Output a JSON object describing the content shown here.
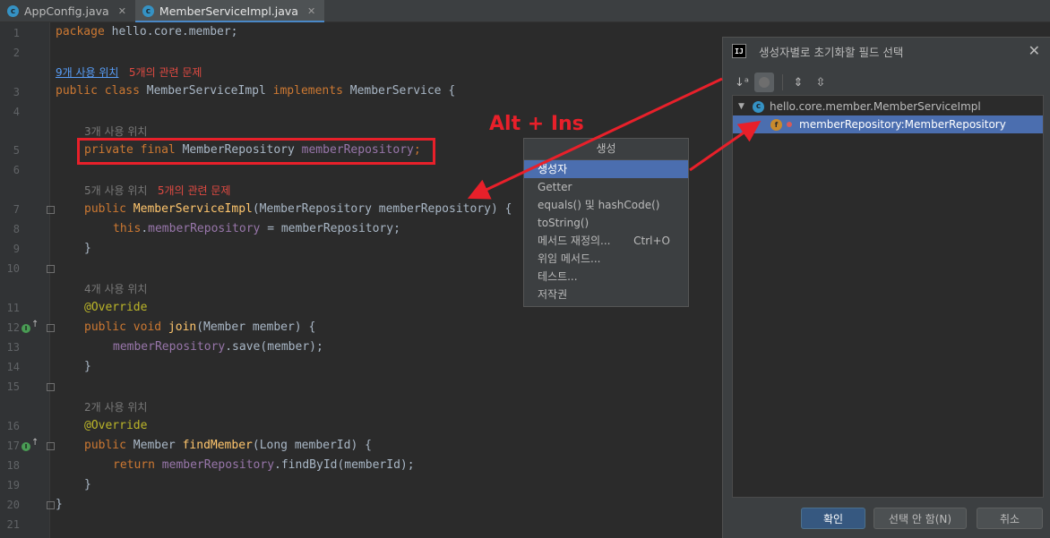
{
  "tabs": [
    {
      "label": "AppConfig.java",
      "icon": "class-icon"
    },
    {
      "label": "MemberServiceImpl.java",
      "icon": "class-icon"
    }
  ],
  "editor": {
    "line_numbers": [
      "1",
      "2",
      "3",
      "4",
      "5",
      "6",
      "7",
      "8",
      "9",
      "10",
      "11",
      "12",
      "13",
      "14",
      "15",
      "16",
      "17",
      "18",
      "19",
      "20",
      "21"
    ],
    "code": {
      "l1_kw": "package",
      "l1_rest": " hello.core.member;",
      "hint_usages_class": "9개 사용 위치",
      "hint_problems_class": "5개의 관련 문제",
      "l3_kw": "public class",
      "l3_name": " MemberServiceImpl ",
      "l3_kw2": "implements",
      "l3_rest": " MemberService {",
      "hint_usages_field": "3개 사용 위치",
      "l5_kw": "private final",
      "l5_type": " MemberRepository ",
      "l5_field": "memberRepository",
      "l5_semi": ";",
      "hint_usages_ctor": "5개 사용 위치",
      "hint_problems_ctor": "5개의 관련 문제",
      "l7_kw": "public",
      "l7_fn": " MemberServiceImpl",
      "l7_rest": "(MemberRepository memberRepository) {",
      "l8_kw": "this",
      "l8_dot": ".",
      "l8_field": "memberRepository",
      "l8_rest": " = memberRepository;",
      "l9": "}",
      "hint_usages_join": "4개 사용 위치",
      "l11_ann": "@Override",
      "l12_kw": "public void",
      "l12_fn": " join",
      "l12_rest": "(Member member) {",
      "l13_field": "memberRepository",
      "l13_rest": ".save(member);",
      "l14": "}",
      "hint_usages_find": "2개 사용 위치",
      "l16_ann": "@Override",
      "l17_kw": "public",
      "l17_type": " Member ",
      "l17_fn": "findMember",
      "l17_rest": "(Long memberId) {",
      "l18_kw": "return",
      "l18_sp": " ",
      "l18_field": "memberRepository",
      "l18_rest": ".findById(memberId);",
      "l19": "}",
      "l20": "}"
    }
  },
  "annotation": {
    "label": "Alt + Ins",
    "color": "#e8202a"
  },
  "generate_popup": {
    "title": "생성",
    "items": [
      {
        "label": "생성자",
        "shortcut": ""
      },
      {
        "label": "Getter",
        "shortcut": ""
      },
      {
        "label": "equals() 및 hashCode()",
        "shortcut": ""
      },
      {
        "label": "toString()",
        "shortcut": ""
      },
      {
        "label": "메서드 재정의...",
        "shortcut": "Ctrl+O"
      },
      {
        "label": "위임 메서드...",
        "shortcut": ""
      },
      {
        "label": "테스트...",
        "shortcut": ""
      },
      {
        "label": "저작권",
        "shortcut": ""
      }
    ],
    "selected": "생성자"
  },
  "dialog": {
    "title": "생성자별로 초기화할 필드 선택",
    "toolbar_icons": [
      "sort-alpha-icon",
      "show-fields-icon",
      "expand-all-icon",
      "collapse-all-icon"
    ],
    "tree": {
      "root": "hello.core.member.MemberServiceImpl",
      "child": "memberRepository:MemberRepository"
    },
    "buttons": {
      "ok": "확인",
      "select_none": "선택 안 함(N)",
      "cancel": "취소"
    }
  },
  "colors": {
    "selection": "#4b6eaf",
    "keyword": "#cc7832",
    "field": "#9876aa",
    "method": "#ffc66d",
    "annotation_red": "#e8202a"
  }
}
